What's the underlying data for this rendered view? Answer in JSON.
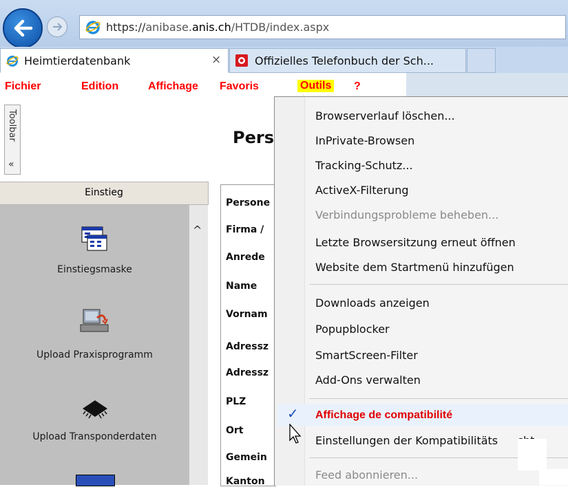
{
  "browser": {
    "url_scheme": "https://",
    "url_host_pre": "anibase.",
    "url_host": "anis.ch",
    "url_path": "/HTDB/index.aspx",
    "tabs": [
      {
        "label": "Heimtierdatenbank",
        "close": "×"
      },
      {
        "label": "Offizielles Telefonbuch der Sch..."
      }
    ]
  },
  "menubar": {
    "items": [
      "Fichier",
      "Edition",
      "Affichage",
      "Favoris",
      "Outils",
      "?"
    ]
  },
  "sidebar": {
    "toolbar_label": "Toolbar",
    "toolbar_chevron": "«",
    "header": "Einstieg",
    "scroll_up": "^",
    "items": [
      {
        "label": "Einstiegsmaske",
        "icon": "form-window-icon"
      },
      {
        "label": "Upload Praxisprogramm",
        "icon": "upload-computer-icon"
      },
      {
        "label": "Upload Transponderdaten",
        "icon": "microchip-icon"
      }
    ]
  },
  "page": {
    "title": "Pers",
    "form_labels": [
      "Persone",
      "Firma /",
      "Anrede",
      "Name",
      "Vornam",
      "Adressz",
      "Adressz",
      "PLZ",
      "Ort",
      "Gemein",
      "Kanton"
    ]
  },
  "tools_menu": {
    "items": [
      {
        "label": "Browserverlauf löschen...",
        "enabled": true
      },
      {
        "label": "InPrivate-Browsen",
        "enabled": true
      },
      {
        "label": "Tracking-Schutz...",
        "enabled": true
      },
      {
        "label": "ActiveX-Filterung",
        "enabled": true
      },
      {
        "label": "Verbindungsprobleme beheben...",
        "enabled": false
      },
      {
        "label": "Letzte Browsersitzung erneut öffnen",
        "enabled": true
      },
      {
        "label": "Website dem Startmenü hinzufügen",
        "enabled": true
      },
      {
        "label": "Downloads anzeigen",
        "enabled": true
      },
      {
        "label": "Popupblocker",
        "enabled": true
      },
      {
        "label": "SmartScreen-Filter",
        "enabled": true
      },
      {
        "label": "Add-Ons verwalten",
        "enabled": true
      },
      {
        "label": "Affichage de compatibilité",
        "checked": true
      },
      {
        "label": "Einstellungen der Kompatibilitäts",
        "suffix": "cht"
      },
      {
        "label": "Feed abonnieren...",
        "enabled": false
      }
    ],
    "check_mark": "✓"
  },
  "colors": {
    "menu_text": "#ff0000",
    "highlight": "#ffff00",
    "sidebar_bg": "#bfbfbf"
  }
}
